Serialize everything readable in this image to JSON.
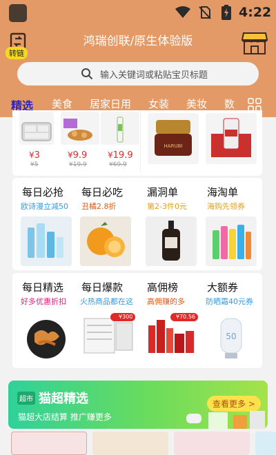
{
  "status": {
    "time": "4:22"
  },
  "header": {
    "convert_badge": "转链",
    "title": "鸿瑞创联/原生体验版"
  },
  "search": {
    "placeholder": "输入关键词或粘贴宝贝标题"
  },
  "tabs": [
    "精选",
    "美食",
    "居家日用",
    "女装",
    "美妆",
    "数"
  ],
  "top_products": [
    {
      "price_prefix": "¥",
      "price": "3",
      "old": "¥5"
    },
    {
      "price_prefix": "¥",
      "price": "9.9",
      "old": "¥19.9"
    },
    {
      "price_prefix": "¥",
      "price": "19.9",
      "old": "¥69.9"
    }
  ],
  "grid_row1": [
    {
      "title": "每日必抢",
      "sub": "欧诗漫立减50",
      "sub_color": "#2d9be6"
    },
    {
      "title": "每日必吃",
      "sub": "丑橘2.8折",
      "sub_color": "#e05a18"
    },
    {
      "title": "漏洞单",
      "sub": "第2-3件0元",
      "sub_color": "#e0a11a"
    },
    {
      "title": "海淘单",
      "sub": "海购先领券",
      "sub_color": "#e0a11a"
    }
  ],
  "grid_row2": [
    {
      "title": "每日精选",
      "sub": "好多优惠折扣",
      "sub_color": "#e0207a"
    },
    {
      "title": "每日爆款",
      "sub": "火热商品都在这",
      "sub_color": "#2d9be6"
    },
    {
      "title": "高佣榜",
      "sub": "高佣赚的多",
      "sub_color": "#e05a18"
    },
    {
      "title": "大额券",
      "sub": "防晒霜40元券",
      "sub_color": "#2d9be6"
    }
  ],
  "tags": {
    "tag1": "¥300",
    "tag2": "¥70.56"
  },
  "maochao": {
    "badge": "超市",
    "title": "猫超精选",
    "sub": "猫超大店结算 推广赚更多",
    "more": "查看更多 >"
  },
  "colors": {
    "header": "#e39a66",
    "active_tab": "#2b22c8",
    "price": "#e02a2a"
  }
}
